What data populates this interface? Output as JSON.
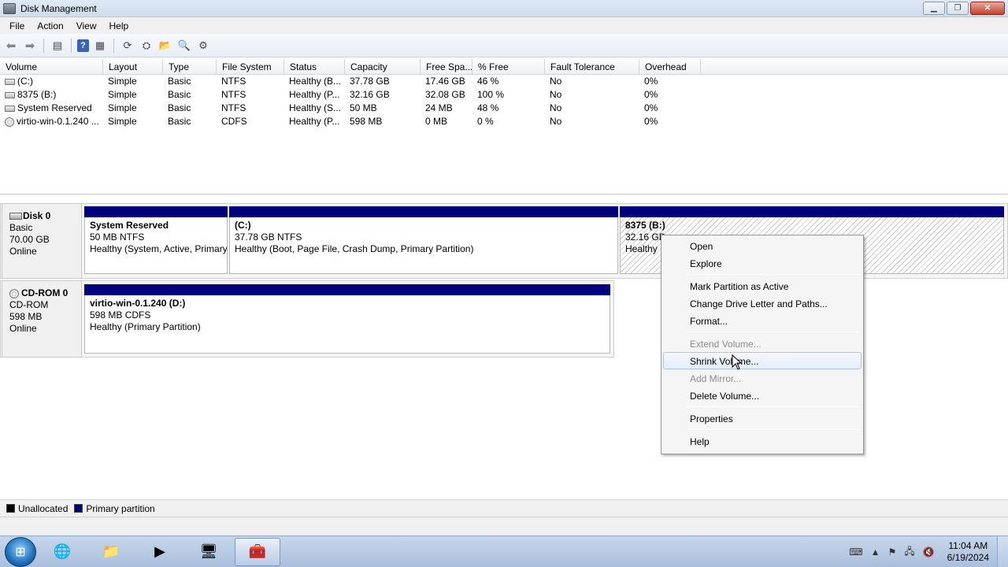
{
  "window": {
    "title": "Disk Management"
  },
  "menu": [
    "File",
    "Action",
    "View",
    "Help"
  ],
  "toolbar": {
    "icons": [
      "back-icon",
      "forward-icon",
      "console-tree-icon",
      "help-icon",
      "properties-icon",
      "refresh-icon",
      "rescan-icon",
      "open-folder-icon",
      "search-icon",
      "settings-icon"
    ]
  },
  "volumes": {
    "headers": [
      "Volume",
      "Layout",
      "Type",
      "File System",
      "Status",
      "Capacity",
      "Free Spa...",
      "% Free",
      "Fault Tolerance",
      "Overhead"
    ],
    "rows": [
      [
        "(C:)",
        "Simple",
        "Basic",
        "NTFS",
        "Healthy (B...",
        "37.78 GB",
        "17.46 GB",
        "46 %",
        "No",
        "0%"
      ],
      [
        "8375 (B:)",
        "Simple",
        "Basic",
        "NTFS",
        "Healthy (P...",
        "32.16 GB",
        "32.08 GB",
        "100 %",
        "No",
        "0%"
      ],
      [
        "System Reserved",
        "Simple",
        "Basic",
        "NTFS",
        "Healthy (S...",
        "50 MB",
        "24 MB",
        "48 %",
        "No",
        "0%"
      ],
      [
        "virtio-win-0.1.240 ...",
        "Simple",
        "Basic",
        "CDFS",
        "Healthy (P...",
        "598 MB",
        "0 MB",
        "0 %",
        "No",
        "0%"
      ]
    ]
  },
  "disk0": {
    "name": "Disk 0",
    "type": "Basic",
    "size": "70.00 GB",
    "state": "Online",
    "partitions": [
      {
        "name": "System Reserved",
        "size": "50 MB NTFS",
        "status": "Healthy (System, Active, Primary Partition)"
      },
      {
        "name": "(C:)",
        "size": "37.78 GB NTFS",
        "status": "Healthy (Boot, Page File, Crash Dump, Primary Partition)"
      },
      {
        "name": "8375  (B:)",
        "size": "32.16 GB",
        "status": "Healthy"
      }
    ]
  },
  "cdrom0": {
    "name": "CD-ROM 0",
    "type": "CD-ROM",
    "size": "598 MB",
    "state": "Online",
    "partition": {
      "name": "virtio-win-0.1.240  (D:)",
      "size": "598 MB CDFS",
      "status": "Healthy (Primary Partition)"
    }
  },
  "legend": {
    "unallocated": "Unallocated",
    "primary": "Primary partition",
    "unallocated_color": "#000000",
    "primary_color": "#00007f"
  },
  "context_menu": {
    "open": "Open",
    "explore": "Explore",
    "mark_active": "Mark Partition as Active",
    "change_letter": "Change Drive Letter and Paths...",
    "format": "Format...",
    "extend": "Extend Volume...",
    "shrink": "Shrink Volume...",
    "add_mirror": "Add Mirror...",
    "delete": "Delete Volume...",
    "properties": "Properties",
    "help": "Help"
  },
  "taskbar": {
    "time": "11:04 AM",
    "date": "6/19/2024"
  }
}
